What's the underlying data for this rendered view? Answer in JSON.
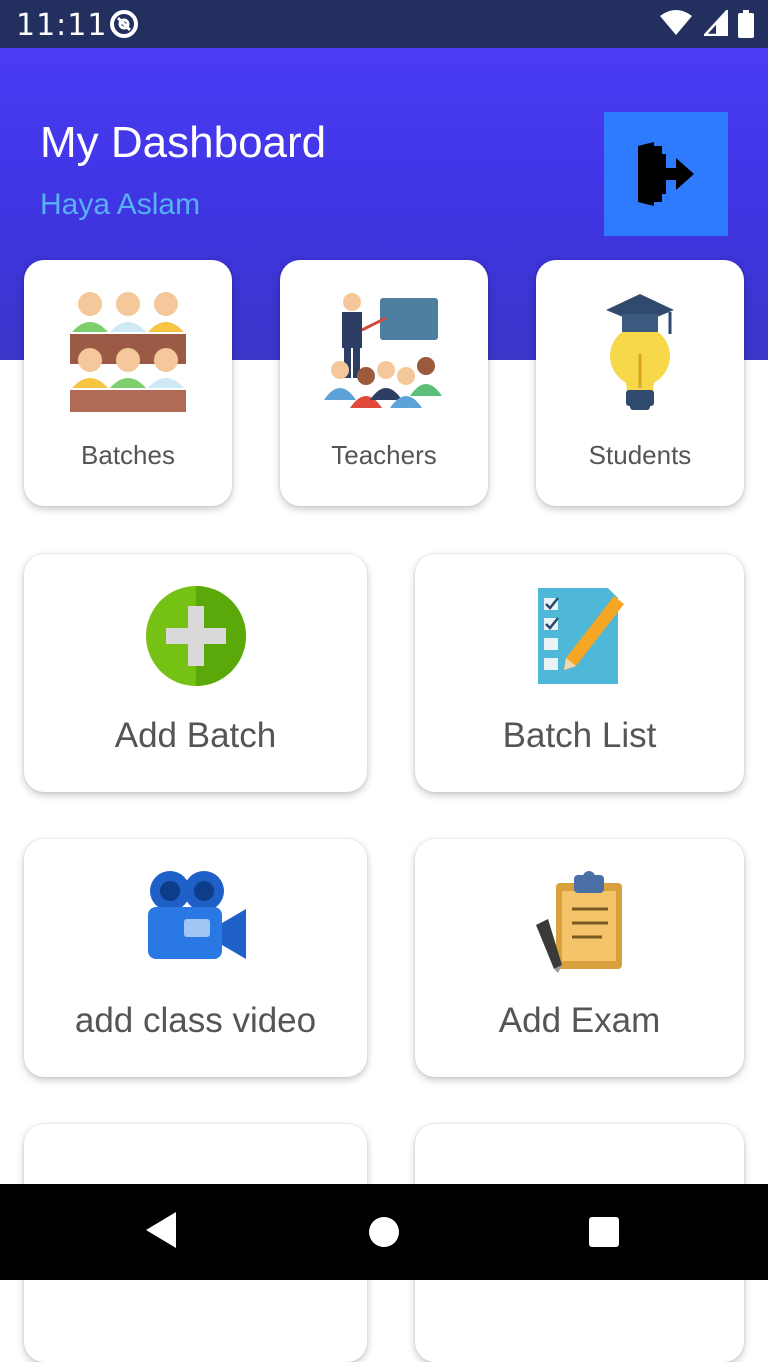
{
  "status_bar": {
    "time": "11:11",
    "icons": [
      "at-sign-icon",
      "wifi-icon",
      "signal-icon",
      "battery-icon"
    ]
  },
  "header": {
    "title": "My Dashboard",
    "user_name": "Haya Aslam",
    "logout_icon": "logout-icon"
  },
  "summary_cards": [
    {
      "label": "Batches",
      "icon": "batches-icon"
    },
    {
      "label": "Teachers",
      "icon": "teachers-icon"
    },
    {
      "label": "Students",
      "icon": "students-icon"
    }
  ],
  "action_cards": [
    {
      "label": "Add Batch",
      "icon": "add-batch-icon"
    },
    {
      "label": "Batch List",
      "icon": "batch-list-icon"
    },
    {
      "label": "add class video",
      "icon": "video-camera-icon"
    },
    {
      "label": "Add Exam",
      "icon": "exam-clipboard-icon"
    }
  ],
  "colors": {
    "status_bar": "#23305f",
    "header_gradient_top": "#4b3cf5",
    "header_gradient_bottom": "#3a36c8",
    "logout_button": "#2f7bff",
    "user_name": "#56b2f3",
    "card_label": "#555555"
  },
  "nav_bar": {
    "buttons": [
      "back-icon",
      "home-icon",
      "recents-icon"
    ]
  }
}
